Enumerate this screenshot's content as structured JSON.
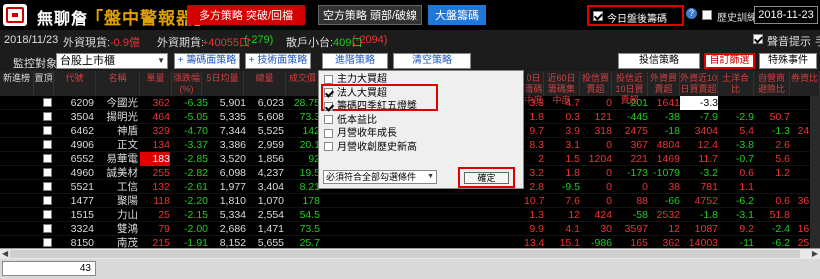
{
  "app": {
    "name": "無聊詹",
    "subtitle": "「盤中警報器」"
  },
  "toolbar": {
    "long_label": "多方策略  突破/回檔",
    "short_label": "空方策略  頭部/破線",
    "market_label": "大盤籌碼",
    "after_hours_label": "今日盤後籌碼",
    "after_hours_checked": true,
    "backtest_label": "歷史訓練模式",
    "backtest_checked": false,
    "date": "2018-11-23"
  },
  "status": {
    "date": "2018/11/23",
    "fx_label": "外資現貨:",
    "fx_value": "-0.9億",
    "inv_label": "外資期貨:",
    "inv_value": "+40055口",
    "inv_change": "(-279)",
    "adv_label": "散戶小台:",
    "adv_value": "409口",
    "adv_change": "(-2094)",
    "sound_label": "聲音提示",
    "sound_checked": true,
    "extra": "手"
  },
  "watch": {
    "label": "監控對象",
    "selected": "台股上市櫃",
    "tabs": [
      "籌碼面策略",
      "技術面策略",
      "進階策略",
      "清空策略"
    ],
    "right_tabs": [
      "投信策略",
      "自訂篩選",
      "特殊事件"
    ]
  },
  "headers": [
    "新進榜",
    "置頂",
    "代號",
    "名稱",
    "單量",
    "漲跌幅(%)",
    "5日均量",
    "總量",
    "成交價",
    "外資日...",
    "",
    "",
    "",
    "",
    "",
    "0日籌碼中度",
    "近60日籌碼集中度",
    "投信買賣超",
    "投信近10日買賣超",
    "外資買賣超",
    "外資近10日買賣超",
    "土洋合比",
    "自營商避險比",
    "券資比"
  ],
  "rows": [
    {
      "code": "6209",
      "name": "今國光",
      "vol": "362",
      "chg": "-6.35",
      "ma5": "5,901",
      "total": "6,023",
      "price": "28.75",
      "c60": "3.3",
      "c60b": "4.7",
      "it": "0",
      "it10": "-201",
      "fi": "1641",
      "fi10": "-3.3",
      "ty": "",
      "dr": "",
      "ms": ""
    },
    {
      "code": "3504",
      "name": "揚明光",
      "vol": "464",
      "chg": "-5.05",
      "ma5": "5,335",
      "total": "5,608",
      "price": "73.3",
      "c60": "1.8",
      "c60b": "0.3",
      "it": "121",
      "it10": "-445",
      "fi": "-38",
      "fi10": "-7.9",
      "ty": "-2.9",
      "dr": "50.7",
      "ms": ""
    },
    {
      "code": "6462",
      "name": "神盾",
      "vol": "329",
      "chg": "-4.70",
      "ma5": "7,344",
      "total": "5,525",
      "price": "142",
      "c60": "9.7",
      "c60b": "3.9",
      "it": "318",
      "it10": "2475",
      "fi": "-18",
      "fi10": "3404",
      "ty": "5.4",
      "dr": "-1.3",
      "ms": "24.0"
    },
    {
      "code": "4906",
      "name": "正文",
      "vol": "134",
      "chg": "-3.37",
      "ma5": "3,386",
      "total": "2,959",
      "price": "20.1",
      "c60": "8.3",
      "c60b": "3.1",
      "it": "0",
      "it10": "367",
      "fi": "4804",
      "fi10": "12.4",
      "ty": "-3.8",
      "dr": "2.6",
      "ms": ""
    },
    {
      "code": "6552",
      "name": "易華電",
      "vol": "183",
      "chg": "-2.85",
      "ma5": "3,520",
      "total": "1,856",
      "price": "92",
      "c60": "2",
      "c60b": "1.5",
      "it": "1204",
      "it10": "221",
      "fi": "1469",
      "fi10": "11.7",
      "ty": "-0.7",
      "dr": "5.6",
      "ms": ""
    },
    {
      "code": "4960",
      "name": "誠美材",
      "vol": "255",
      "chg": "-2.82",
      "ma5": "6,098",
      "total": "4,237",
      "price": "19.5",
      "c60": "3.2",
      "c60b": "1.8",
      "it": "0",
      "it10": "-173",
      "fi": "-1079",
      "fi10": "-3.2",
      "ty": "0.6",
      "dr": "1.2",
      "ms": ""
    },
    {
      "code": "5521",
      "name": "工信",
      "vol": "132",
      "chg": "-2.61",
      "ma5": "1,977",
      "total": "3,404",
      "price": "8.21",
      "c60": "2.8",
      "c60b": "-9.5",
      "it": "0",
      "it10": "0",
      "fi": "38",
      "fi10": "781",
      "ty": "1.1",
      "dr": "",
      "ms": ""
    },
    {
      "code": "1477",
      "name": "聚陽",
      "vol": "118",
      "chg": "-2.20",
      "ma5": "1,810",
      "total": "1,070",
      "price": "178",
      "c60": "10.7",
      "c60b": "7.6",
      "it": "0",
      "it10": "88",
      "fi": "-66",
      "fi10": "4752",
      "ty": "-6.2",
      "dr": "0.6",
      "ms": "36.4"
    },
    {
      "code": "1515",
      "name": "力山",
      "vol": "25",
      "chg": "-2.15",
      "ma5": "5,334",
      "total": "2,554",
      "price": "54.5",
      "c60": "1.3",
      "c60b": "12",
      "it": "424",
      "it10": "-58",
      "fi": "2532",
      "fi10": "-1.8",
      "ty": "-3.1",
      "dr": "51.8",
      "ms": ""
    },
    {
      "code": "3324",
      "name": "雙鴻",
      "vol": "79",
      "chg": "-2.00",
      "ma5": "2,686",
      "total": "1,471",
      "price": "73.5",
      "c60": "9.9",
      "c60b": "4.1",
      "it": "30",
      "it10": "3597",
      "fi": "12",
      "fi10": "1087",
      "ty": "9.2",
      "dr": "-2.4",
      "ms": "16.0"
    },
    {
      "code": "8150",
      "name": "南茂",
      "vol": "215",
      "chg": "-1.91",
      "ma5": "8,152",
      "total": "5,655",
      "price": "25.7",
      "c60": "13.4",
      "c60b": "15.1",
      "it": "-986",
      "it10": "165",
      "fi": "362",
      "fi10": "14003",
      "ty": "-11",
      "dr": "-6.2",
      "ms": "25.4"
    }
  ],
  "footer": {
    "count": "43"
  },
  "popup": {
    "items": [
      {
        "label": "主力大買超",
        "checked": false
      },
      {
        "label": "法人大買超",
        "checked": true
      },
      {
        "label": "籌碼四季紅五燈獎",
        "checked": true
      },
      {
        "label": "低本益比",
        "checked": false
      },
      {
        "label": "月營收年成長",
        "checked": false
      },
      {
        "label": "月營收創歷史新高",
        "checked": false
      }
    ],
    "select": "必須符合全部勾選條件",
    "ok": "確定"
  },
  "colors": {
    "up": "#e33",
    "down": "#2c2",
    "accent": "#d40000",
    "market": "#1f78d8"
  }
}
